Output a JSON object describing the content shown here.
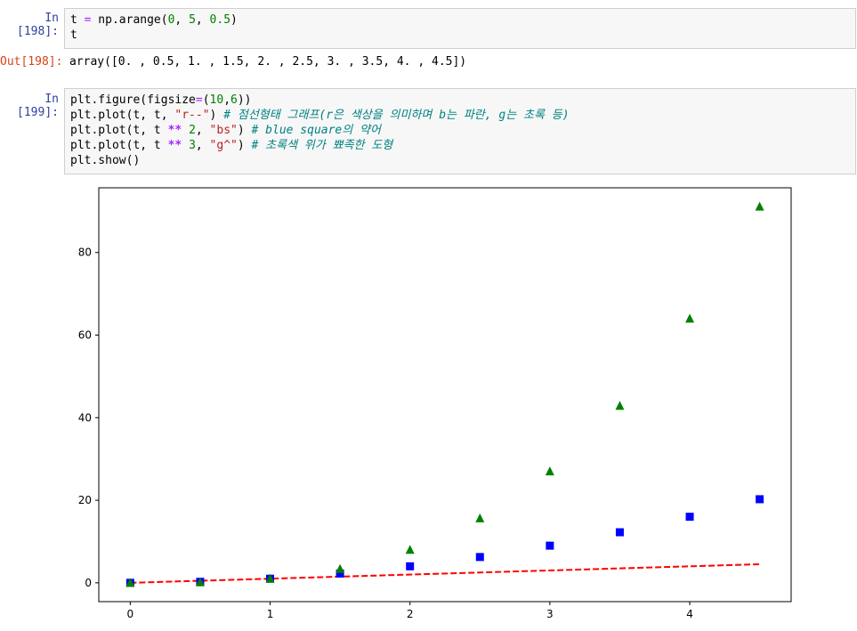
{
  "cells": [
    {
      "prompt": "In [198]:",
      "lines": [
        [
          {
            "t": "t "
          },
          {
            "t": "=",
            "c": "op"
          },
          {
            "t": " np.arange("
          },
          {
            "t": "0",
            "c": "num"
          },
          {
            "t": ", "
          },
          {
            "t": "5",
            "c": "num"
          },
          {
            "t": ", "
          },
          {
            "t": "0.5",
            "c": "num"
          },
          {
            "t": ")"
          }
        ],
        [
          {
            "t": "t"
          }
        ]
      ]
    },
    {
      "prompt": "In [199]:",
      "lines": [
        [
          {
            "t": "plt.figure(figsize"
          },
          {
            "t": "=",
            "c": "op"
          },
          {
            "t": "("
          },
          {
            "t": "10",
            "c": "num"
          },
          {
            "t": ","
          },
          {
            "t": "6",
            "c": "num"
          },
          {
            "t": "))"
          }
        ],
        [
          {
            "t": "plt.plot(t, t, "
          },
          {
            "t": "\"r--\"",
            "c": "str"
          },
          {
            "t": ") "
          },
          {
            "t": "# 점선형태 그래프(r은 색상을 의미하며 b는 파란, g는 초록 등)",
            "c": "cmt"
          }
        ],
        [
          {
            "t": "plt.plot(t, t "
          },
          {
            "t": "**",
            "c": "kw-op"
          },
          {
            "t": " "
          },
          {
            "t": "2",
            "c": "num"
          },
          {
            "t": ", "
          },
          {
            "t": "\"bs\"",
            "c": "str"
          },
          {
            "t": ") "
          },
          {
            "t": "# blue square의 약어",
            "c": "cmt"
          }
        ],
        [
          {
            "t": "plt.plot(t, t "
          },
          {
            "t": "**",
            "c": "kw-op"
          },
          {
            "t": " "
          },
          {
            "t": "3",
            "c": "num"
          },
          {
            "t": ", "
          },
          {
            "t": "\"g^\"",
            "c": "str"
          },
          {
            "t": ") "
          },
          {
            "t": "# 초록색 위가 뾰족한 도형",
            "c": "cmt"
          }
        ],
        [
          {
            "t": "plt.show()"
          }
        ]
      ]
    }
  ],
  "output": {
    "prompt": "Out[198]:",
    "text": "array([0. , 0.5, 1. , 1.5, 2. , 2.5, 3. , 3.5, 4. , 4.5])"
  },
  "chart_data": {
    "type": "line",
    "x": [
      0,
      0.5,
      1,
      1.5,
      2,
      2.5,
      3,
      3.5,
      4,
      4.5
    ],
    "xlim": [
      -0.225,
      4.725
    ],
    "ylim": [
      -4.556,
      95.681
    ],
    "xticks": [
      0,
      1,
      2,
      3,
      4
    ],
    "yticks": [
      0,
      20,
      40,
      60,
      80
    ],
    "grid": false,
    "series": [
      {
        "style": "dashed-line",
        "color": "#ff0000",
        "values": [
          0,
          0.5,
          1,
          1.5,
          2,
          2.5,
          3,
          3.5,
          4,
          4.5
        ]
      },
      {
        "style": "square-marker",
        "color": "#0000ff",
        "values": [
          0,
          0.25,
          1,
          2.25,
          4,
          6.25,
          9,
          12.25,
          16,
          20.25
        ]
      },
      {
        "style": "triangle-marker",
        "color": "#008000",
        "values": [
          0,
          0.125,
          1,
          3.375,
          8,
          15.625,
          27,
          42.875,
          64,
          91.125
        ]
      }
    ]
  }
}
